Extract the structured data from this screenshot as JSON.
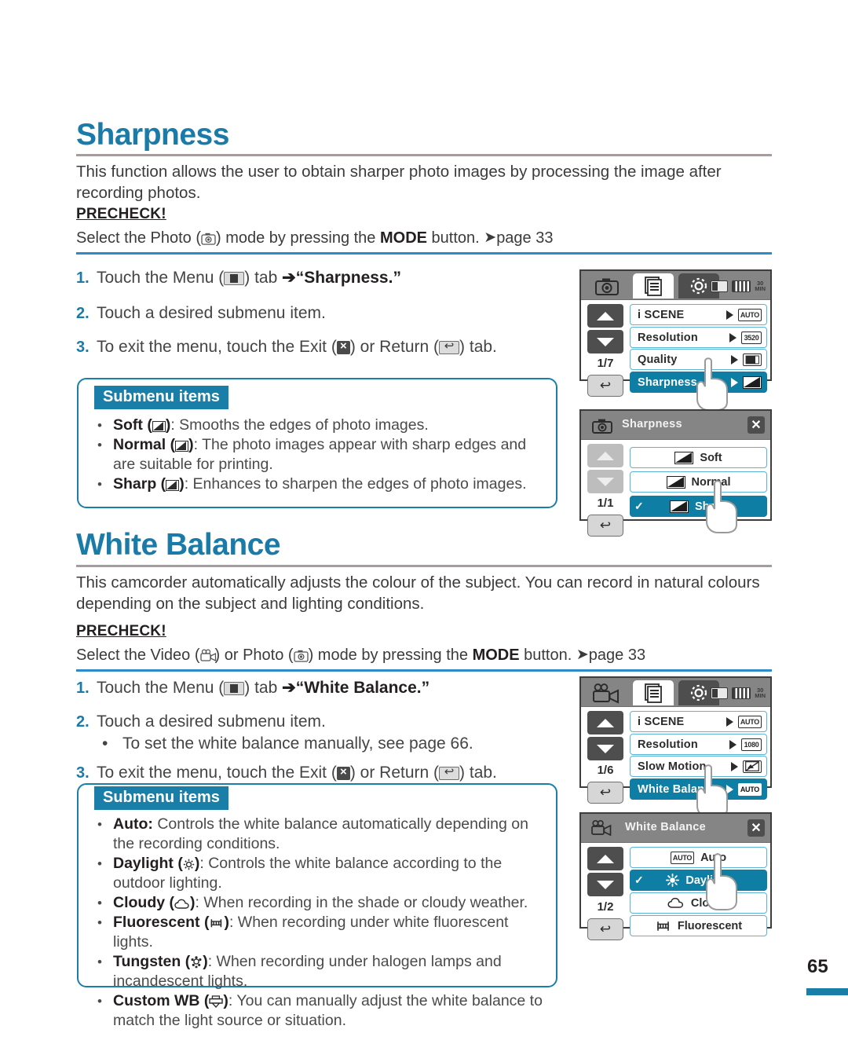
{
  "page": {
    "number": "65"
  },
  "sections": [
    {
      "id": "sharpness",
      "title": "Sharpness",
      "intro": "This function allows the user to obtain sharper photo images by processing the image after recording photos.",
      "precheck_label": "PRECHECK!",
      "precheck_text_a": "Select the Photo (",
      "precheck_text_b": ") mode by pressing the ",
      "precheck_mode": "MODE",
      "precheck_text_c": " button. ",
      "precheck_page": "page 33",
      "steps": [
        {
          "num": "1.",
          "a": "Touch the Menu (",
          "b": ") tab ",
          "arrow": "➔",
          "c": "“Sharpness.”"
        },
        {
          "num": "2.",
          "a": "Touch a desired submenu item.",
          "b": "",
          "c": ""
        },
        {
          "num": "3.",
          "a": "To exit the menu, touch the Exit (",
          "b": ") or Return (",
          "c": ") tab."
        }
      ],
      "submenu_badge": "Submenu items",
      "submenu_items": [
        {
          "name": "Soft",
          "icon": "sharpness-soft-icon",
          "desc": ": Smooths the edges of photo images."
        },
        {
          "name": "Normal",
          "icon": "sharpness-normal-icon",
          "desc": ": The photo images appear with sharp edges and are suitable for printing."
        },
        {
          "name": "Sharp",
          "icon": "sharpness-sharp-icon",
          "desc": ": Enhances to sharpen the edges of photo images."
        }
      ]
    },
    {
      "id": "white-balance",
      "title": "White Balance",
      "intro": "This camcorder automatically adjusts the colour of the subject. You can record in natural colours depending on the subject and lighting conditions.",
      "precheck_label": "PRECHECK!",
      "precheck_text_a": "Select the Video (",
      "precheck_text_mid": ") or Photo (",
      "precheck_text_b": ") mode by pressing the ",
      "precheck_mode": "MODE",
      "precheck_text_c": " button. ",
      "precheck_page": "page 33",
      "steps": [
        {
          "num": "1.",
          "a": "Touch the Menu (",
          "b": ") tab ",
          "arrow": "➔",
          "c": "“White Balance.”"
        },
        {
          "num": "2.",
          "a": "Touch a desired submenu item.",
          "b": "",
          "c": ""
        },
        {
          "num": "3.",
          "a": "To exit the menu, touch the Exit (",
          "b": ") or Return (",
          "c": ") tab."
        }
      ],
      "substep": "To set the white balance manually, see page 66.",
      "submenu_badge": "Submenu items",
      "submenu_items": [
        {
          "name": "Auto:",
          "icon": "",
          "desc": " Controls the white balance automatically depending on the recording conditions."
        },
        {
          "name": "Daylight",
          "icon": "sun-icon",
          "desc": ": Controls the white balance according to the outdoor lighting."
        },
        {
          "name": "Cloudy",
          "icon": "cloud-icon",
          "desc": ": When recording in the shade or cloudy weather."
        },
        {
          "name": "Fluorescent",
          "icon": "fluorescent-icon",
          "desc": ": When recording under white fluorescent lights."
        },
        {
          "name": "Tungsten",
          "icon": "tungsten-icon",
          "desc": ": When recording under halogen lamps and incandescent lights."
        },
        {
          "name": "Custom WB",
          "icon": "custom-wb-icon",
          "desc": ": You can manually adjust the white balance to match the light source or situation."
        }
      ]
    }
  ],
  "lcds": [
    {
      "id": "sharpness-menu",
      "type": "tabbed",
      "mode_icon": "photo-camera-icon",
      "tabs": [
        "photo-mode-tab",
        "menu-tab",
        "settings-tab"
      ],
      "status": {
        "card": "memory-card-icon",
        "battery": "battery-icon",
        "time": "30",
        "time_unit": "MIN"
      },
      "page_indicator": "1/7",
      "return_label": "↩",
      "rows": [
        {
          "label": "i SCENE",
          "value_type": "badge",
          "value": "AUTO",
          "selected": false
        },
        {
          "label": "Resolution",
          "value_type": "badge",
          "value": "3520",
          "selected": false
        },
        {
          "label": "Quality",
          "value_type": "quality-icon",
          "value": "",
          "selected": false
        },
        {
          "label": "Sharpness",
          "value_type": "sharp-icon",
          "value": "",
          "selected": true
        }
      ]
    },
    {
      "id": "sharpness-submenu",
      "type": "titled",
      "mode_icon": "photo-camera-icon",
      "title": "Sharpness",
      "close_label": "✕",
      "page_indicator": "1/1",
      "return_label": "↩",
      "nav_dim": true,
      "rows": [
        {
          "label": "Soft",
          "icon": "sharpness-soft-icon",
          "selected": false,
          "checked": false
        },
        {
          "label": "Normal",
          "icon": "sharpness-normal-icon",
          "selected": false,
          "checked": false
        },
        {
          "label": "Sharp",
          "icon": "sharpness-sharp-icon",
          "selected": true,
          "checked": true
        }
      ]
    },
    {
      "id": "white-balance-menu",
      "type": "tabbed",
      "mode_icon": "video-camera-icon",
      "tabs": [
        "video-mode-tab",
        "menu-tab",
        "settings-tab"
      ],
      "status": {
        "card": "memory-card-icon",
        "battery": "battery-icon",
        "time": "30",
        "time_unit": "MIN"
      },
      "page_indicator": "1/6",
      "return_label": "↩",
      "rows": [
        {
          "label": "i SCENE",
          "value_type": "badge",
          "value": "AUTO",
          "selected": false
        },
        {
          "label": "Resolution",
          "value_type": "badge",
          "value": "1080",
          "selected": false
        },
        {
          "label": "Slow Motion",
          "value_type": "slow-motion-icon",
          "value": "",
          "selected": false
        },
        {
          "label": "White Balance",
          "value_type": "badge",
          "value": "AUTO",
          "selected": true
        }
      ]
    },
    {
      "id": "white-balance-submenu",
      "type": "titled",
      "mode_icon": "video-camera-icon",
      "title": "White Balance",
      "close_label": "✕",
      "page_indicator": "1/2",
      "return_label": "↩",
      "nav_dim": false,
      "rows": [
        {
          "label": "Auto",
          "icon": "auto-badge-icon",
          "selected": false,
          "checked": false
        },
        {
          "label": "Daylight",
          "icon": "sun-icon",
          "selected": true,
          "checked": true
        },
        {
          "label": "Cloudy",
          "icon": "cloud-icon",
          "selected": false,
          "checked": false
        },
        {
          "label": "Fluorescent",
          "icon": "fluorescent-icon",
          "selected": false,
          "checked": false
        }
      ]
    }
  ],
  "colors": {
    "accent": "#1a7fa8",
    "heading": "#1b7ba8",
    "selected_row": "#0e7ea4",
    "rule": "#a59d9b",
    "precheck_rule": "#2e8bc9"
  }
}
